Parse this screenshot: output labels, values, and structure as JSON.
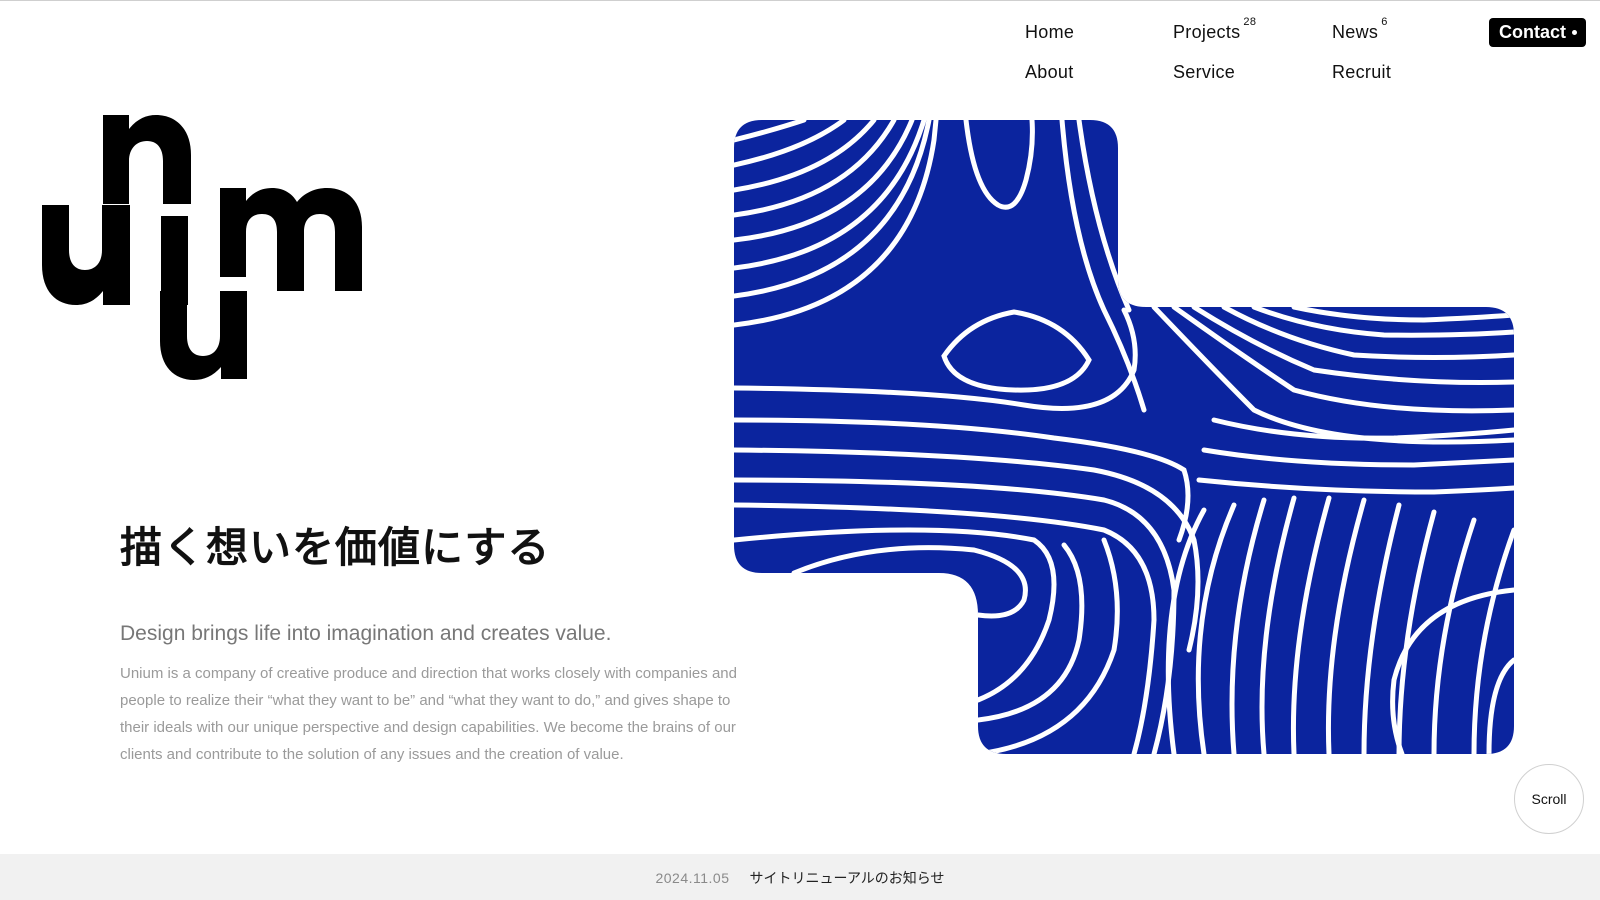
{
  "nav": {
    "home": "Home",
    "about": "About",
    "projects": "Projects",
    "projects_count": "28",
    "service": "Service",
    "news": "News",
    "news_count": "6",
    "recruit": "Recruit",
    "contact": "Contact"
  },
  "logo": {
    "alt": "unium"
  },
  "hero": {
    "headline_jp": "描く想いを価値にする",
    "headline_en": "Design brings life into imagination and creates value.",
    "description": "Unium is a company of creative produce and direction that works closely with companies and people to realize their “what they want to be” and “what they want to do,” and gives shape to their ideals with our unique perspective and design capabilities. We become the brains of our clients and contribute to the solution of any issues and the creation of value."
  },
  "scroll": {
    "label": "Scroll"
  },
  "news_bar": {
    "date": "2024.11.05",
    "title": "サイトリニューアルのお知らせ"
  },
  "colors": {
    "brand_blue": "#0b249e",
    "text": "#111111",
    "muted": "#9a9a9a",
    "news_bg": "#f1f1f1"
  },
  "icons": {
    "contact_dot": "dot-icon"
  }
}
